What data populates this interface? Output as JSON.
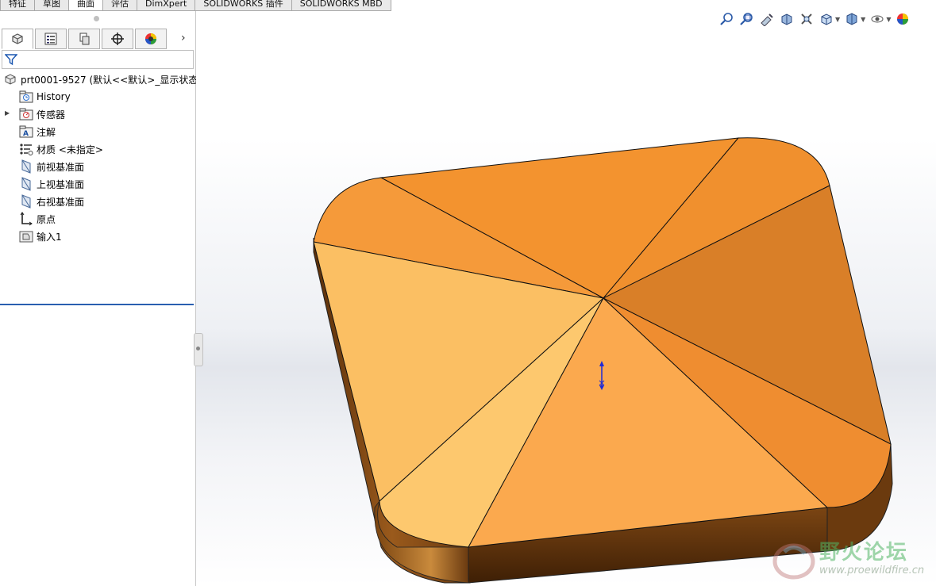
{
  "command_tabs": [
    "特征",
    "草图",
    "曲面",
    "评估",
    "DimXpert",
    "SOLIDWORKS 插件",
    "SOLIDWORKS MBD"
  ],
  "active_tab_index": 2,
  "manager_tabs": [
    {
      "name": "featuremanager-tab",
      "icon": "part-tree-icon"
    },
    {
      "name": "propertymanager-tab",
      "icon": "property-list-icon"
    },
    {
      "name": "configurationmanager-tab",
      "icon": "configuration-icon"
    },
    {
      "name": "dimxpertmanager-tab",
      "icon": "crosshair-icon"
    },
    {
      "name": "displaymanager-tab",
      "icon": "appearance-sphere-icon"
    }
  ],
  "tree": {
    "root_label": "prt0001-9527  (默认<<默认>_显示状态",
    "items": [
      {
        "label": "History",
        "icon": "history-folder-icon"
      },
      {
        "label": "传感器",
        "icon": "sensor-folder-icon"
      },
      {
        "label": "注解",
        "icon": "annotation-folder-icon",
        "expandable": true
      },
      {
        "label": "材质 <未指定>",
        "icon": "material-icon"
      },
      {
        "label": "前视基准面",
        "icon": "plane-icon"
      },
      {
        "label": "上视基准面",
        "icon": "plane-icon"
      },
      {
        "label": "右视基准面",
        "icon": "plane-icon"
      },
      {
        "label": "原点",
        "icon": "origin-icon"
      },
      {
        "label": "输入1",
        "icon": "imported-body-icon"
      }
    ]
  },
  "watermark": {
    "title": "野火论坛",
    "url": "www.proewildfire.cn"
  },
  "colors": {
    "accent_rollback": "#2a5fb0",
    "model_face_light": "#fbbf63",
    "model_face_mid": "#f3932f",
    "model_face_dark": "#d97f28",
    "model_side": "#7a4410",
    "triad_blue": "#1f2bd6"
  }
}
